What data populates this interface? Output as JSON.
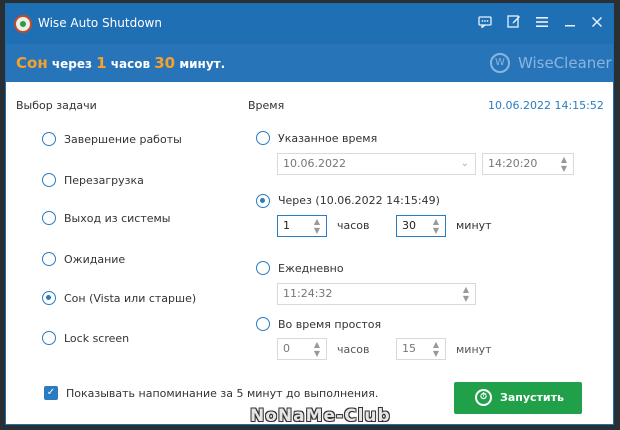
{
  "window": {
    "title": "Wise Auto Shutdown"
  },
  "titlebar_icons": [
    "feedback-icon",
    "edit-icon",
    "menu-icon",
    "minimize-icon",
    "close-icon"
  ],
  "status": {
    "action": "Сон",
    "via": "через",
    "hours_val": "1",
    "hours_unit": "часов",
    "minutes_val": "30",
    "minutes_unit": "минут."
  },
  "brand": {
    "name": "WiseCleaner",
    "logo_letter": "W"
  },
  "task": {
    "heading": "Выбор задачи",
    "options": [
      {
        "label": "Завершение работы",
        "checked": false
      },
      {
        "label": "Перезагрузка",
        "checked": false
      },
      {
        "label": "Выход из системы",
        "checked": false
      },
      {
        "label": "Ожидание",
        "checked": false
      },
      {
        "label": "Сон (Vista или старше)",
        "checked": true
      },
      {
        "label": "Lock screen",
        "checked": false
      }
    ]
  },
  "time": {
    "heading": "Время",
    "current": "10.06.2022 14:15:52",
    "specified": {
      "label": "Указанное время",
      "date": "10.06.2022",
      "time": "14:20:20"
    },
    "after": {
      "label": "Через (10.06.2022 14:15:49)",
      "hours": "1",
      "hours_unit": "часов",
      "minutes": "30",
      "minutes_unit": "минут"
    },
    "daily": {
      "label": "Ежедневно",
      "time": "11:24:32"
    },
    "idle": {
      "label": "Во время простоя",
      "hours": "0",
      "hours_unit": "часов",
      "minutes": "15",
      "minutes_unit": "минут"
    }
  },
  "reminder": {
    "label": "Показывать напоминание за 5 минут до выполнения."
  },
  "start_button": {
    "label": "Запустить"
  },
  "watermark": "NoNaMe-Club",
  "colors": {
    "titlebar": "#1f6fb5",
    "banner": "#2874b9",
    "accent": "#2a7cc1",
    "status_orange": "#f6a12a",
    "start_green": "#21a04a"
  }
}
